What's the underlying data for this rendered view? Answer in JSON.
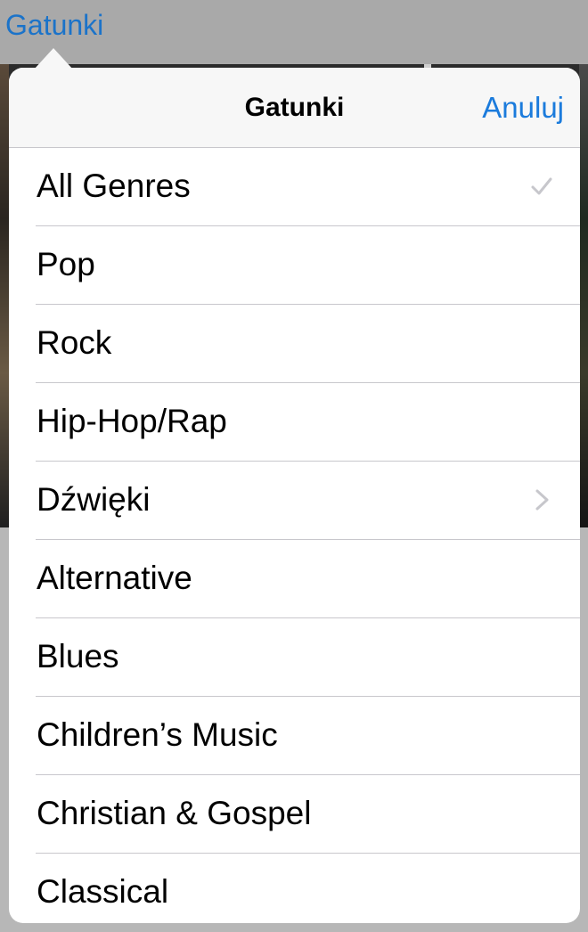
{
  "background": {
    "nav_button": "Gatunki"
  },
  "popover": {
    "title": "Gatunki",
    "cancel_label": "Anuluj",
    "items": [
      {
        "label": "All Genres",
        "accessory": "checkmark-icon",
        "selected": true
      },
      {
        "label": "Pop",
        "accessory": ""
      },
      {
        "label": "Rock",
        "accessory": ""
      },
      {
        "label": "Hip-Hop/Rap",
        "accessory": ""
      },
      {
        "label": "Dźwięki",
        "accessory": "chevron-right-icon"
      },
      {
        "label": "Alternative",
        "accessory": ""
      },
      {
        "label": "Blues",
        "accessory": ""
      },
      {
        "label": "Children’s Music",
        "accessory": ""
      },
      {
        "label": "Christian & Gospel",
        "accessory": ""
      },
      {
        "label": "Classical",
        "accessory": ""
      }
    ]
  },
  "colors": {
    "accent": "#1b7bdc",
    "separator": "#c8c7cc",
    "header_bg": "#f7f7f7"
  }
}
